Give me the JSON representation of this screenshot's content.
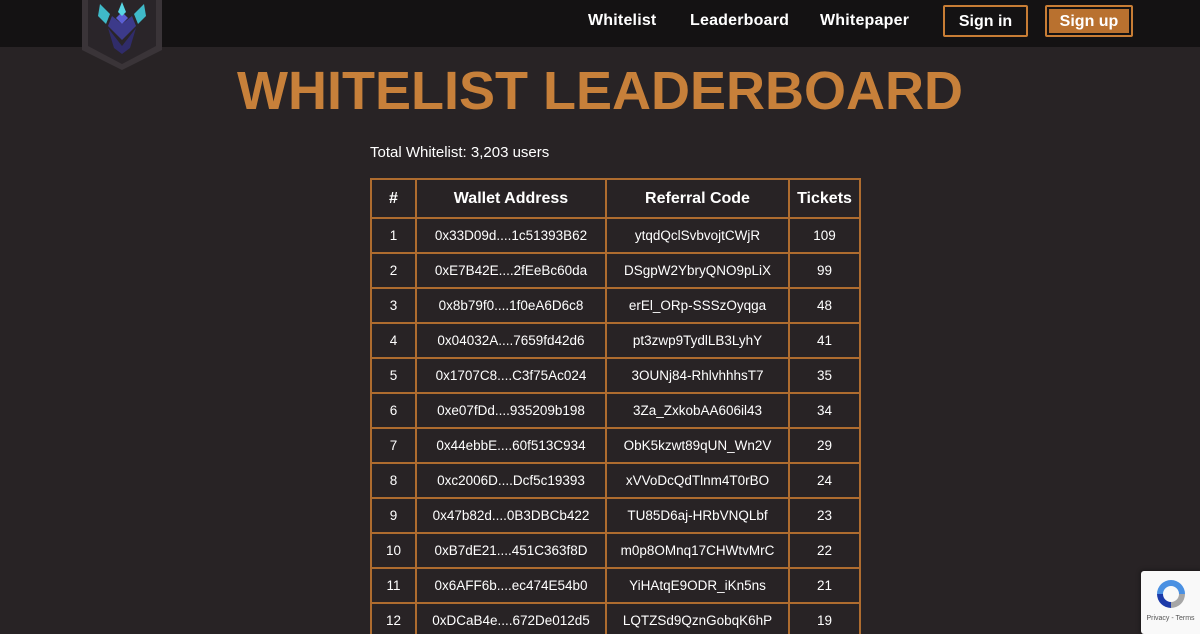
{
  "colors": {
    "background": "#282325",
    "topbar": "#141213",
    "accent": "#c7803a",
    "border": "#ae6c2f",
    "signup_fill": "#b9712f"
  },
  "header": {
    "logo_icon": "winged-emblem-logo",
    "nav": [
      {
        "label": "Whitelist"
      },
      {
        "label": "Leaderboard"
      },
      {
        "label": "Whitepaper"
      }
    ],
    "signin_label": "Sign in",
    "signup_label": "Sign up"
  },
  "main": {
    "title": "WHITELIST LEADERBOARD",
    "total_label": "Total Whitelist:",
    "total_value": "3,203 users"
  },
  "table": {
    "headers": [
      "#",
      "Wallet Address",
      "Referral Code",
      "Tickets"
    ],
    "rows": [
      [
        "1",
        "0x33D09d....1c51393B62",
        "ytqdQclSvbvojtCWjR",
        "109"
      ],
      [
        "2",
        "0xE7B42E....2fEeBc60da",
        "DSgpW2YbryQNO9pLiX",
        "99"
      ],
      [
        "3",
        "0x8b79f0....1f0eA6D6c8",
        "erEl_ORp-SSSzOyqga",
        "48"
      ],
      [
        "4",
        "0x04032A....7659fd42d6",
        "pt3zwp9TydlLB3LyhY",
        "41"
      ],
      [
        "5",
        "0x1707C8....C3f75Ac024",
        "3OUNj84-RhlvhhhsT7",
        "35"
      ],
      [
        "6",
        "0xe07fDd....935209b198",
        "3Za_ZxkobAA606il43",
        "34"
      ],
      [
        "7",
        "0x44ebbE....60f513C934",
        "ObK5kzwt89qUN_Wn2V",
        "29"
      ],
      [
        "8",
        "0xc2006D....Dcf5c19393",
        "xVVoDcQdTlnm4T0rBO",
        "24"
      ],
      [
        "9",
        "0x47b82d....0B3DBCb422",
        "TU85D6aj-HRbVNQLbf",
        "23"
      ],
      [
        "10",
        "0xB7dE21....451C363f8D",
        "m0p8OMnq17CHWtvMrC",
        "22"
      ],
      [
        "11",
        "0x6AFF6b....ec474E54b0",
        "YiHAtqE9ODR_iKn5ns",
        "21"
      ],
      [
        "12",
        "0xDCaB4e....672De012d5",
        "LQTZSd9QznGobqK6hP",
        "19"
      ]
    ]
  },
  "recaptcha": {
    "icon": "recaptcha-icon",
    "text": "Privacy - Terms"
  }
}
